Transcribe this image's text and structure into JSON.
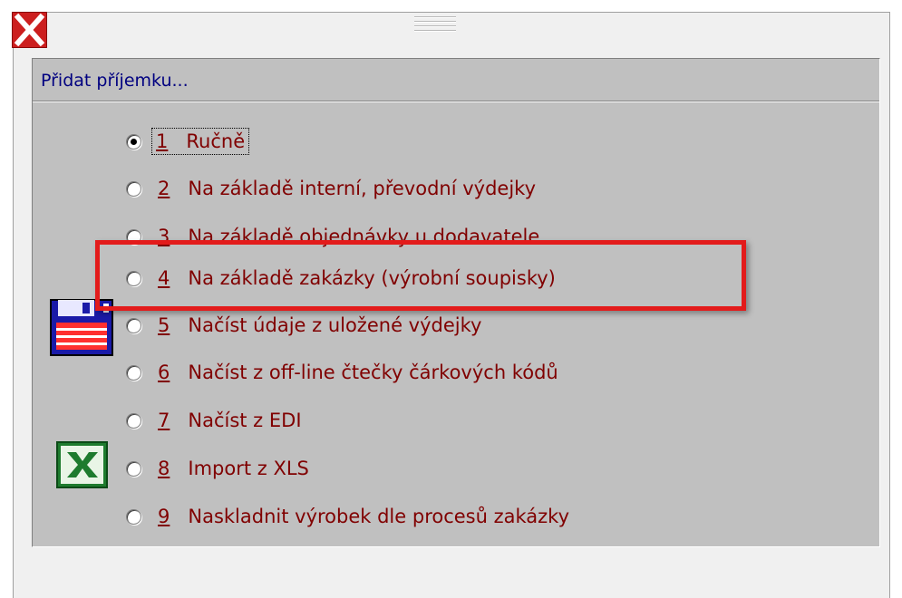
{
  "window": {
    "close_icon": "close-x-icon",
    "grip_icon": "drag-grip-icon"
  },
  "panel": {
    "title": "Přidat příjemku..."
  },
  "options": [
    {
      "number": "1",
      "label": "Ručně",
      "checked": true
    },
    {
      "number": "2",
      "label": "Na základě interní, převodní výdejky",
      "checked": false
    },
    {
      "number": "3",
      "label": "Na základě objednávky u dodavatele",
      "checked": false
    },
    {
      "number": "4",
      "label": "Na základě zakázky (výrobní soupisky)",
      "checked": false
    },
    {
      "number": "5",
      "label": "Načíst údaje z uložené výdejky",
      "checked": false
    },
    {
      "number": "6",
      "label": "Načíst z off-line čtečky čárkových kódů",
      "checked": false
    },
    {
      "number": "7",
      "label": "Načíst z EDI",
      "checked": false
    },
    {
      "number": "8",
      "label": "Import z XLS",
      "checked": false
    },
    {
      "number": "9",
      "label": "Naskladnit výrobek dle procesů zakázky",
      "checked": false
    }
  ],
  "icons": {
    "save": "floppy-disk-icon",
    "excel": "excel-icon"
  },
  "colors": {
    "option_text": "#800000",
    "title_text": "#000080",
    "highlight": "#e31b1b",
    "close_button": "#cc1f1f"
  }
}
